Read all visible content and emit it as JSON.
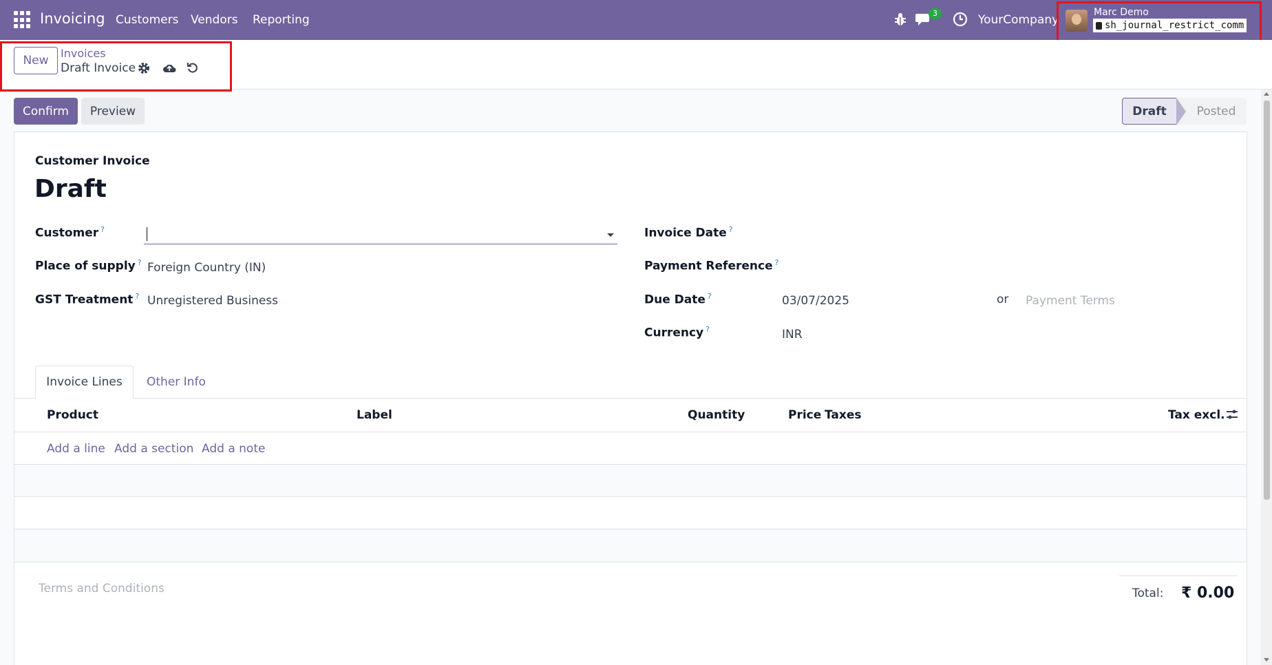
{
  "navbar": {
    "app_name": "Invoicing",
    "menu": [
      "Customers",
      "Vendors",
      "Reporting"
    ],
    "messages_count": "3",
    "company": "YourCompany",
    "user_name": "Marc Demo",
    "database": "sh_journal_restrict_comm",
    "bg_color": "#71639e"
  },
  "control": {
    "new_label": "New",
    "breadcrumb": "Invoices",
    "record_title": "Draft Invoice"
  },
  "actions": {
    "confirm": "Confirm",
    "preview": "Preview"
  },
  "statusbar": {
    "steps": [
      "Draft",
      "Posted"
    ],
    "active": "Draft"
  },
  "form": {
    "doc_type": "Customer Invoice",
    "doc_name": "Draft",
    "left_fields": [
      {
        "label": "Customer",
        "value": ""
      },
      {
        "label": "Place of supply",
        "value": "Foreign Country (IN)"
      },
      {
        "label": "GST Treatment",
        "value": "Unregistered Business"
      }
    ],
    "right_fields": [
      {
        "label": "Invoice Date",
        "value": ""
      },
      {
        "label": "Payment Reference",
        "value": ""
      },
      {
        "label": "Due Date",
        "value": "03/07/2025"
      },
      {
        "label": "Currency",
        "value": "INR"
      }
    ],
    "due_or": "or",
    "payment_terms_placeholder": "Payment Terms",
    "help_mark": "?"
  },
  "tabs": [
    "Invoice Lines",
    "Other Info"
  ],
  "table": {
    "headers": [
      "Product",
      "Label",
      "Quantity",
      "Price",
      "Taxes",
      "Tax excl."
    ],
    "add_links": [
      "Add a line",
      "Add a section",
      "Add a note"
    ]
  },
  "footer": {
    "terms_placeholder": "Terms and Conditions",
    "total_label": "Total:",
    "total_value": "₹ 0.00"
  }
}
